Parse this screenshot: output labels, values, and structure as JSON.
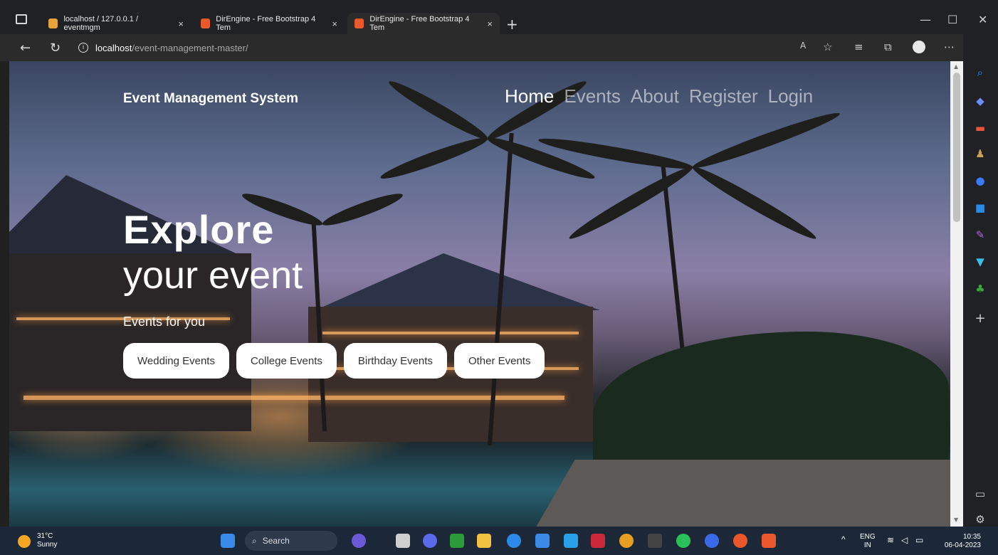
{
  "browser": {
    "tabs": [
      {
        "title": "localhost / 127.0.0.1 / eventmgm",
        "close": "×"
      },
      {
        "title": "DirEngine - Free Bootstrap 4 Tem",
        "close": "×"
      },
      {
        "title": "DirEngine - Free Bootstrap 4 Tem",
        "close": "×"
      }
    ],
    "new_tab": "+",
    "window_controls": {
      "minimize": "—",
      "maximize": "☐",
      "close": "✕"
    },
    "url_host": "localhost",
    "url_path": "/event-management-master/"
  },
  "site": {
    "brand": "Event Management System",
    "nav": [
      "Home",
      "Events",
      "About",
      "Register",
      "Login"
    ],
    "hero_line1": "Explore",
    "hero_line2": "your event",
    "hero_sub": "Events for you",
    "categories": [
      "Wedding Events",
      "College Events",
      "Birthday Events",
      "Other Events"
    ]
  },
  "taskbar": {
    "temp": "31°C",
    "weather": "Sunny",
    "search": "Search",
    "lang1": "ENG",
    "lang2": "IN",
    "time": "10:35",
    "date": "06-04-2023"
  },
  "colors": {
    "tab_bg": "#202124",
    "address_bg": "#2b2b2b",
    "taskbar_bg": "#1c2838"
  }
}
